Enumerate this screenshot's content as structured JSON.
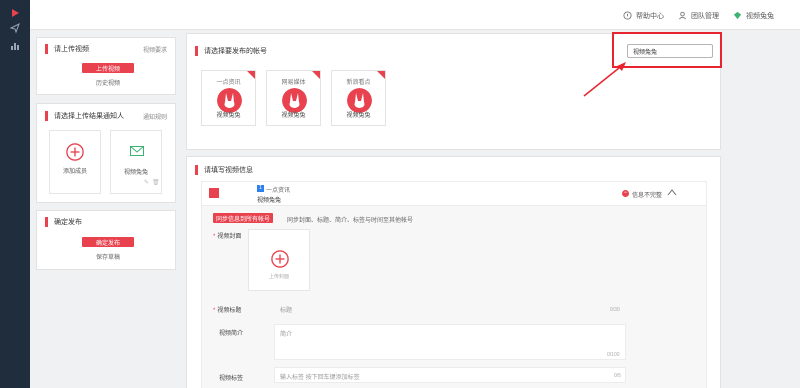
{
  "topbar": {
    "help_label": "帮助中心",
    "team_label": "团队管理",
    "account_label": "视频兔兔"
  },
  "upload_card": {
    "title": "请上传视频",
    "requirements_link": "视频要求",
    "upload_button": "上传视频",
    "history_link": "历史视频"
  },
  "notify_card": {
    "title": "请选择上传结果通知人",
    "rules_link": "通知规则",
    "add_member_label": "添加成员",
    "member_name": "视频兔兔"
  },
  "publish_card": {
    "title": "确定发布",
    "confirm_button": "确定发布",
    "save_draft_link": "保存草稿"
  },
  "accounts_card": {
    "title": "请选择要发布的帐号",
    "search_value": "视频兔兔",
    "accounts": [
      {
        "platform": "一点资讯",
        "name": "视频兔兔"
      },
      {
        "platform": "网易媒体",
        "name": "视频兔兔"
      },
      {
        "platform": "新浪看点",
        "name": "视频兔兔"
      }
    ]
  },
  "video_info_card": {
    "title": "请填写视频信息",
    "account_platform": "一点资讯",
    "account_name": "视频兔兔",
    "status_text": "信息不完整",
    "sync_button": "同步信息到所有帐号",
    "sync_hint": "同步封面、标题、简介、标签与时间至其他帐号",
    "cover_label": "视频封面",
    "cover_upload_text": "上传封面",
    "title_label": "视频标题",
    "title_placeholder": "标题",
    "title_counter": "0/30",
    "desc_label": "视频简介",
    "desc_placeholder": "简介",
    "desc_counter": "0/100",
    "tags_label": "视频标签",
    "tags_placeholder": "输入标签 按下回车键添加标签",
    "tags_counter": "0/5"
  },
  "colors": {
    "accent": "#e8424f",
    "highlight": "#e8252f",
    "sidebar": "#1f2d3d"
  }
}
